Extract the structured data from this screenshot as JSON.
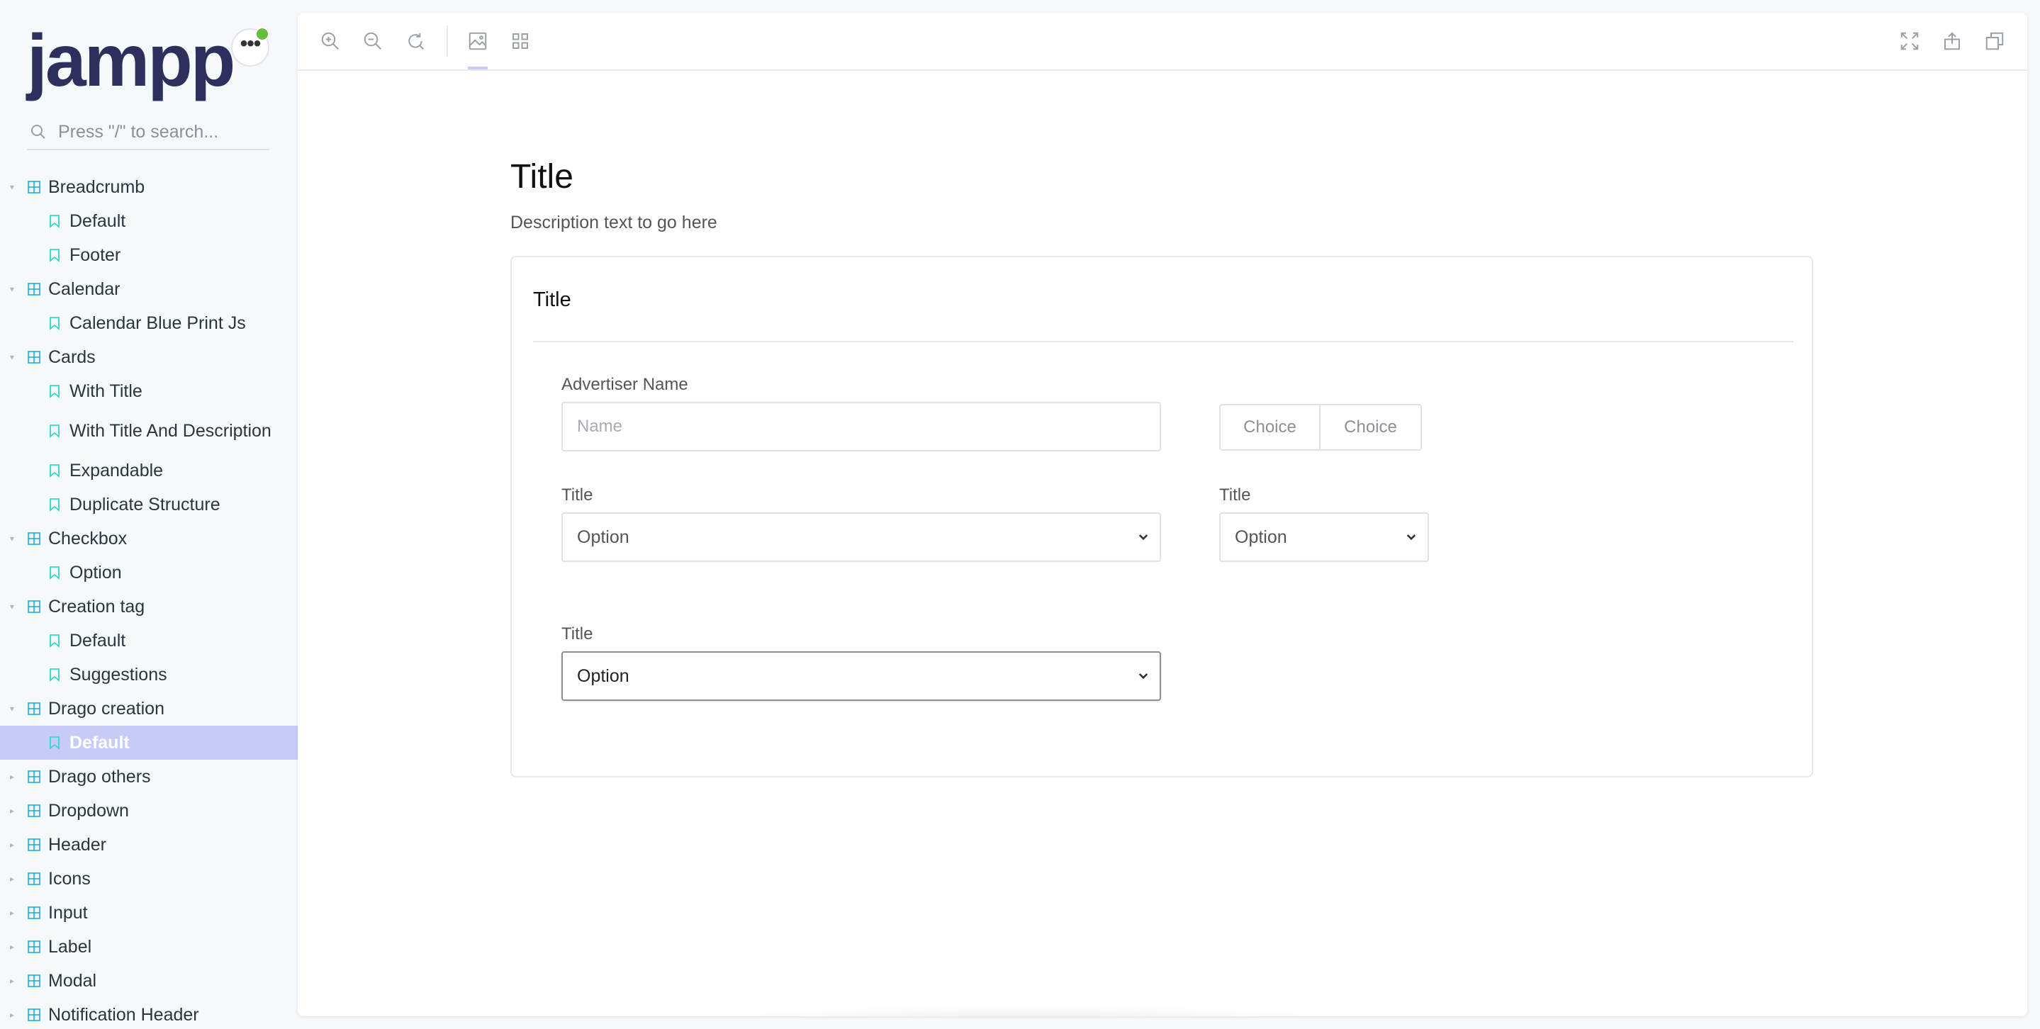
{
  "brand": {
    "logo_text": "jampp",
    "menu_label": "•••",
    "status_color": "#66bf3c"
  },
  "search": {
    "placeholder": "Press \"/\" to search..."
  },
  "tree": [
    {
      "kind": "group",
      "label": "Breadcrumb",
      "expanded": true
    },
    {
      "kind": "story",
      "label": "Default"
    },
    {
      "kind": "story",
      "label": "Footer"
    },
    {
      "kind": "group",
      "label": "Calendar",
      "expanded": true
    },
    {
      "kind": "story",
      "label": "Calendar Blue Print Js"
    },
    {
      "kind": "group",
      "label": "Cards",
      "expanded": true
    },
    {
      "kind": "story",
      "label": "With Title"
    },
    {
      "kind": "story",
      "label": "With Title And Description",
      "tall": true
    },
    {
      "kind": "story",
      "label": "Expandable"
    },
    {
      "kind": "story",
      "label": "Duplicate Structure"
    },
    {
      "kind": "group",
      "label": "Checkbox",
      "expanded": true
    },
    {
      "kind": "story",
      "label": "Option"
    },
    {
      "kind": "group",
      "label": "Creation tag",
      "expanded": true
    },
    {
      "kind": "story",
      "label": "Default"
    },
    {
      "kind": "story",
      "label": "Suggestions"
    },
    {
      "kind": "group",
      "label": "Drago creation",
      "expanded": true
    },
    {
      "kind": "story",
      "label": "Default",
      "selected": true
    },
    {
      "kind": "group",
      "label": "Drago others",
      "expanded": false
    },
    {
      "kind": "group",
      "label": "Dropdown",
      "expanded": false
    },
    {
      "kind": "group",
      "label": "Header",
      "expanded": false
    },
    {
      "kind": "group",
      "label": "Icons",
      "expanded": false
    },
    {
      "kind": "group",
      "label": "Input",
      "expanded": false
    },
    {
      "kind": "group",
      "label": "Label",
      "expanded": false
    },
    {
      "kind": "group",
      "label": "Modal",
      "expanded": false
    },
    {
      "kind": "group",
      "label": "Notification Header",
      "expanded": false
    }
  ],
  "toolbar": {
    "icons": [
      "zoom-in-icon",
      "zoom-out-icon",
      "reset-zoom-icon",
      "image-icon",
      "grid-icon",
      "fullscreen-icon",
      "share-icon",
      "copy-icon"
    ]
  },
  "story": {
    "title": "Title",
    "description": "Description text to go here",
    "card": {
      "title": "Title",
      "advertiser_label": "Advertiser Name",
      "advertiser_placeholder": "Name",
      "advertiser_value": "",
      "choices": [
        "Choice",
        "Choice"
      ],
      "select1": {
        "label": "Title",
        "value": "Option"
      },
      "select2": {
        "label": "Title",
        "value": "Option"
      },
      "select3": {
        "label": "Title",
        "value": "Option"
      }
    }
  },
  "colors": {
    "accent_selected": "#c9cbf7",
    "logo": "#2e2f5c",
    "group_icon": "#1ea7fd",
    "story_icon": "#37d5d3"
  }
}
